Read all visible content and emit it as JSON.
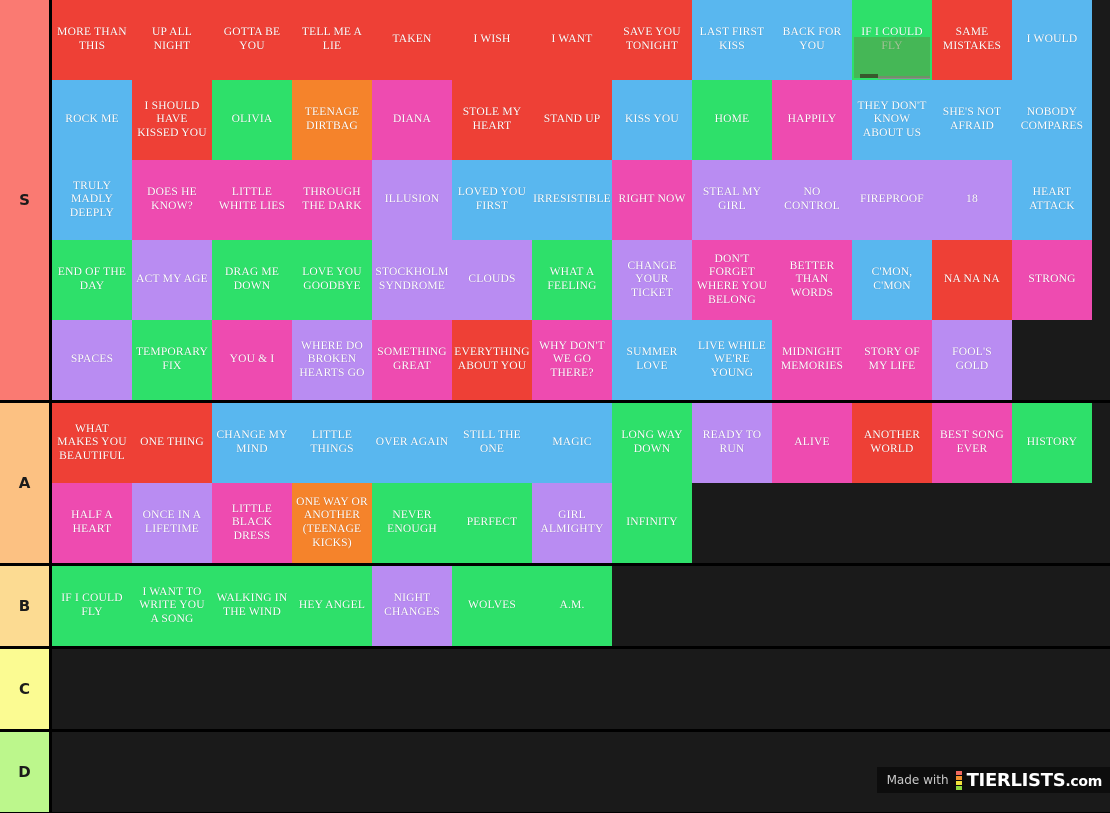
{
  "palette": {
    "red": "#ee4036",
    "blue": "#59b7ef",
    "green": "#2ee06a",
    "orange": "#f5832b",
    "pink": "#ee4bb0",
    "purple": "#b98cf2",
    "empty": "#1a1a1a"
  },
  "tier_label_colors": {
    "S": "#fa7a72",
    "A": "#fcc182",
    "B": "#fcdb92",
    "C": "#fbfb92",
    "D": "#bcf78c"
  },
  "watermark": {
    "made_with": "Made with",
    "brand": "TIERLISTS",
    "dotcom": ".com",
    "logo_bars": [
      "#f0685f",
      "#f5912f",
      "#f2e13b",
      "#8fd93e"
    ]
  },
  "tiers": [
    {
      "label": "S",
      "rows": [
        [
          {
            "t": "MORE THAN THIS",
            "c": "red"
          },
          {
            "t": "UP ALL NIGHT",
            "c": "red"
          },
          {
            "t": "GOTTA BE YOU",
            "c": "red"
          },
          {
            "t": "TELL ME A LIE",
            "c": "red"
          },
          {
            "t": "TAKEN",
            "c": "red"
          },
          {
            "t": "I WISH",
            "c": "red"
          },
          {
            "t": "I WANT",
            "c": "red"
          },
          {
            "t": "SAVE YOU TONIGHT",
            "c": "red"
          },
          {
            "t": "LAST FIRST KISS",
            "c": "blue"
          },
          {
            "t": "BACK FOR YOU",
            "c": "blue"
          },
          {
            "t": "IF I COULD FLY",
            "c": "green",
            "dragging": true,
            "ghost": "FLY"
          },
          {
            "t": "SAME MISTAKES",
            "c": "red"
          },
          {
            "t": "I WOULD",
            "c": "blue"
          }
        ],
        [
          {
            "t": "ROCK ME",
            "c": "blue"
          },
          {
            "t": "I SHOULD HAVE KISSED YOU",
            "c": "red"
          },
          {
            "t": "OLIVIA",
            "c": "green"
          },
          {
            "t": "TEENAGE DIRTBAG",
            "c": "orange"
          },
          {
            "t": "DIANA",
            "c": "pink"
          },
          {
            "t": "STOLE MY HEART",
            "c": "red"
          },
          {
            "t": "STAND UP",
            "c": "red"
          },
          {
            "t": "KISS YOU",
            "c": "blue"
          },
          {
            "t": "HOME",
            "c": "green"
          },
          {
            "t": "HAPPILY",
            "c": "pink"
          },
          {
            "t": "THEY DON'T KNOW ABOUT US",
            "c": "blue"
          },
          {
            "t": "SHE'S NOT AFRAID",
            "c": "blue"
          },
          {
            "t": "NOBODY COMPARES",
            "c": "blue"
          }
        ],
        [
          {
            "t": "TRULY MADLY DEEPLY",
            "c": "blue"
          },
          {
            "t": "DOES HE KNOW?",
            "c": "pink"
          },
          {
            "t": "LITTLE WHITE LIES",
            "c": "pink"
          },
          {
            "t": "THROUGH THE DARK",
            "c": "pink"
          },
          {
            "t": "ILLUSION",
            "c": "purple"
          },
          {
            "t": "LOVED YOU FIRST",
            "c": "blue"
          },
          {
            "t": "IRRESISTIBLE",
            "c": "blue"
          },
          {
            "t": "RIGHT NOW",
            "c": "pink"
          },
          {
            "t": "STEAL MY GIRL",
            "c": "purple"
          },
          {
            "t": "NO CONTROL",
            "c": "purple"
          },
          {
            "t": "FIREPROOF",
            "c": "purple"
          },
          {
            "t": "18",
            "c": "purple"
          },
          {
            "t": "HEART ATTACK",
            "c": "blue"
          }
        ],
        [
          {
            "t": "END OF THE DAY",
            "c": "green"
          },
          {
            "t": "ACT MY AGE",
            "c": "purple"
          },
          {
            "t": "DRAG ME DOWN",
            "c": "green"
          },
          {
            "t": "LOVE YOU GOODBYE",
            "c": "green"
          },
          {
            "t": "STOCKHOLM SYNDROME",
            "c": "purple"
          },
          {
            "t": "CLOUDS",
            "c": "purple"
          },
          {
            "t": "WHAT A FEELING",
            "c": "green"
          },
          {
            "t": "CHANGE YOUR TICKET",
            "c": "purple"
          },
          {
            "t": "DON'T FORGET WHERE YOU BELONG",
            "c": "pink"
          },
          {
            "t": "BETTER THAN WORDS",
            "c": "pink"
          },
          {
            "t": "C'MON, C'MON",
            "c": "blue"
          },
          {
            "t": "NA NA NA",
            "c": "red"
          },
          {
            "t": "STRONG",
            "c": "pink"
          }
        ],
        [
          {
            "t": "SPACES",
            "c": "purple"
          },
          {
            "t": "TEMPORARY FIX",
            "c": "green"
          },
          {
            "t": "YOU & I",
            "c": "pink"
          },
          {
            "t": "WHERE DO BROKEN HEARTS GO",
            "c": "purple"
          },
          {
            "t": "SOMETHING GREAT",
            "c": "pink"
          },
          {
            "t": "EVERYTHING ABOUT YOU",
            "c": "red"
          },
          {
            "t": "WHY DON'T WE GO THERE?",
            "c": "pink"
          },
          {
            "t": "SUMMER LOVE",
            "c": "blue"
          },
          {
            "t": "LIVE WHILE WE'RE YOUNG",
            "c": "blue"
          },
          {
            "t": "MIDNIGHT MEMORIES",
            "c": "pink"
          },
          {
            "t": "STORY OF MY LIFE",
            "c": "pink"
          },
          {
            "t": "FOOL'S GOLD",
            "c": "purple"
          }
        ]
      ]
    },
    {
      "label": "A",
      "rows": [
        [
          {
            "t": "WHAT MAKES YOU BEAUTIFUL",
            "c": "red"
          },
          {
            "t": "ONE THING",
            "c": "red"
          },
          {
            "t": "CHANGE MY MIND",
            "c": "blue"
          },
          {
            "t": "LITTLE THINGS",
            "c": "blue"
          },
          {
            "t": "OVER AGAIN",
            "c": "blue"
          },
          {
            "t": "STILL THE ONE",
            "c": "blue"
          },
          {
            "t": "MAGIC",
            "c": "blue"
          },
          {
            "t": "LONG WAY DOWN",
            "c": "green"
          },
          {
            "t": "READY TO RUN",
            "c": "purple"
          },
          {
            "t": "ALIVE",
            "c": "pink"
          },
          {
            "t": "ANOTHER WORLD",
            "c": "red"
          },
          {
            "t": "BEST SONG EVER",
            "c": "pink"
          },
          {
            "t": "HISTORY",
            "c": "green"
          }
        ],
        [
          {
            "t": "HALF A HEART",
            "c": "pink"
          },
          {
            "t": "ONCE IN A LIFETIME",
            "c": "purple"
          },
          {
            "t": "LITTLE BLACK DRESS",
            "c": "pink"
          },
          {
            "t": "ONE WAY OR ANOTHER (TEENAGE KICKS)",
            "c": "orange"
          },
          {
            "t": "NEVER ENOUGH",
            "c": "green"
          },
          {
            "t": "PERFECT",
            "c": "green"
          },
          {
            "t": "GIRL ALMIGHTY",
            "c": "purple"
          },
          {
            "t": "INFINITY",
            "c": "green"
          }
        ]
      ]
    },
    {
      "label": "B",
      "rows": [
        [
          {
            "t": "IF I COULD FLY",
            "c": "green"
          },
          {
            "t": "I WANT TO WRITE YOU A SONG",
            "c": "green"
          },
          {
            "t": "WALKING IN THE WIND",
            "c": "green"
          },
          {
            "t": "HEY ANGEL",
            "c": "green"
          },
          {
            "t": "NIGHT CHANGES",
            "c": "purple"
          },
          {
            "t": "WOLVES",
            "c": "green"
          },
          {
            "t": "A.M.",
            "c": "green"
          }
        ]
      ]
    },
    {
      "label": "C",
      "rows": [
        []
      ]
    },
    {
      "label": "D",
      "rows": [
        []
      ]
    }
  ]
}
